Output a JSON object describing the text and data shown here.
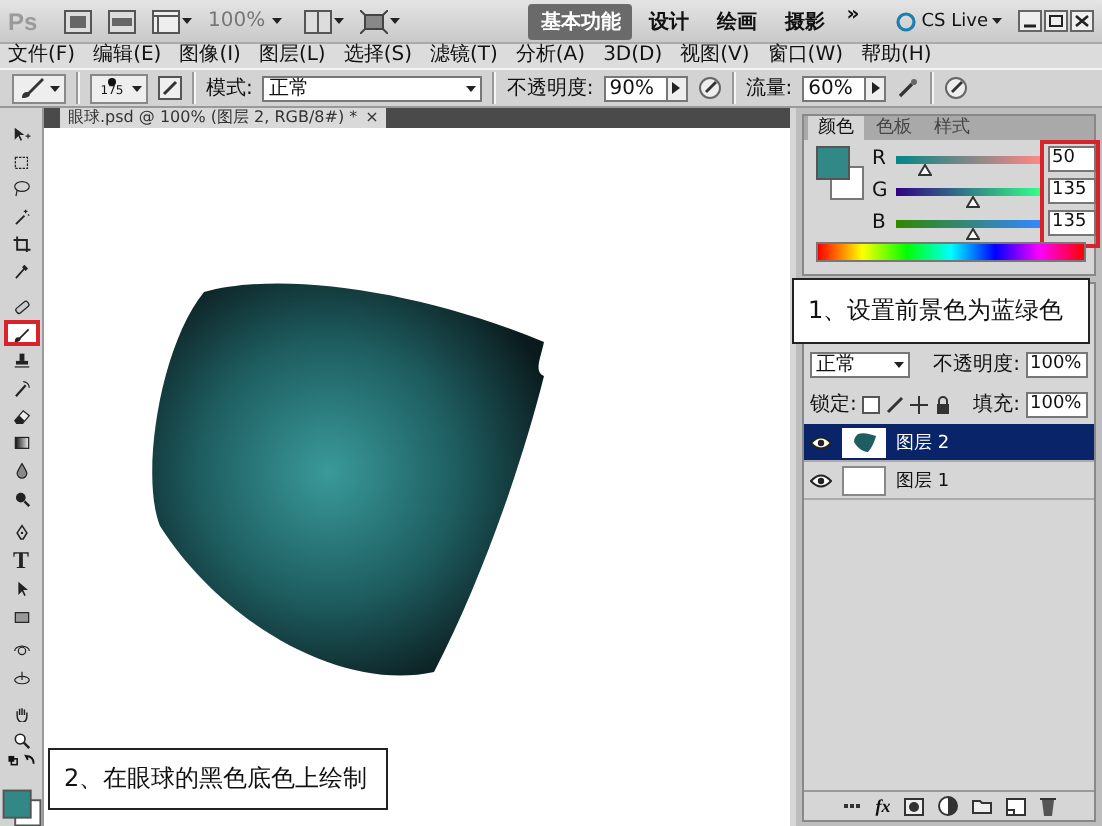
{
  "app_bar": {
    "logo": "Ps",
    "zoom": "100%",
    "workspaces": [
      {
        "label": "基本功能",
        "selected": true
      },
      {
        "label": "设计",
        "selected": false
      },
      {
        "label": "绘画",
        "selected": false
      },
      {
        "label": "摄影",
        "selected": false
      }
    ],
    "more": "»",
    "cs_live": "CS Live"
  },
  "menu": [
    "文件(F)",
    "编辑(E)",
    "图像(I)",
    "图层(L)",
    "选择(S)",
    "滤镜(T)",
    "分析(A)",
    "3D(D)",
    "视图(V)",
    "窗口(W)",
    "帮助(H)"
  ],
  "options": {
    "brush_size": "175",
    "mode_label": "模式:",
    "mode": "正常",
    "opacity_label": "不透明度:",
    "opacity": "90%",
    "flow_label": "流量:",
    "flow": "60%"
  },
  "document": {
    "tab": "眼球.psd @ 100% (图层 2, RGB/8#) *",
    "close": "×"
  },
  "tools": [
    {
      "kind": "move",
      "selected": false
    },
    {
      "kind": "marquee",
      "selected": false
    },
    {
      "kind": "lasso",
      "selected": false
    },
    {
      "kind": "wand",
      "selected": false
    },
    {
      "kind": "crop",
      "selected": false
    },
    {
      "kind": "eyedropper",
      "selected": false
    },
    {
      "kind": "bandage",
      "selected": false
    },
    {
      "kind": "brush",
      "selected": true
    },
    {
      "kind": "stamp",
      "selected": false
    },
    {
      "kind": "history",
      "selected": false
    },
    {
      "kind": "eraser",
      "selected": false
    },
    {
      "kind": "gradient",
      "selected": false
    },
    {
      "kind": "drop",
      "selected": false
    },
    {
      "kind": "dodge",
      "selected": false
    },
    {
      "kind": "pen",
      "selected": false
    },
    {
      "kind": "type",
      "selected": false,
      "label": "T"
    },
    {
      "kind": "select",
      "selected": false
    },
    {
      "kind": "shape",
      "selected": false
    },
    {
      "kind": "rotate3d",
      "selected": false
    },
    {
      "kind": "orbit3d",
      "selected": false
    },
    {
      "kind": "hand",
      "selected": false
    },
    {
      "kind": "zoom",
      "selected": false
    }
  ],
  "color_panel": {
    "tabs": [
      {
        "label": "颜色",
        "selected": true
      },
      {
        "label": "色板",
        "selected": false
      },
      {
        "label": "样式",
        "selected": false
      }
    ],
    "values_highlighted": true,
    "channels": [
      {
        "name": "R",
        "value": "50",
        "level": 0.196
      },
      {
        "name": "G",
        "value": "135",
        "level": 0.529
      },
      {
        "name": "B",
        "value": "135",
        "level": 0.529
      }
    ]
  },
  "layers_panel": {
    "blend_mode": "正常",
    "opacity_label": "不透明度:",
    "opacity": "100%",
    "lock_label": "锁定:",
    "fill_label": "填充:",
    "fill": "100%",
    "style_button": "fx",
    "layers": [
      {
        "name": "图层 2",
        "selected": true,
        "visible": true,
        "kind": "shape"
      },
      {
        "name": "图层 1",
        "selected": false,
        "visible": true,
        "kind": "plain"
      }
    ]
  },
  "callouts": [
    {
      "text": "1、设置前景色为蓝绿色"
    },
    {
      "text": "2、在眼球的黑色底色上绘制"
    }
  ]
}
